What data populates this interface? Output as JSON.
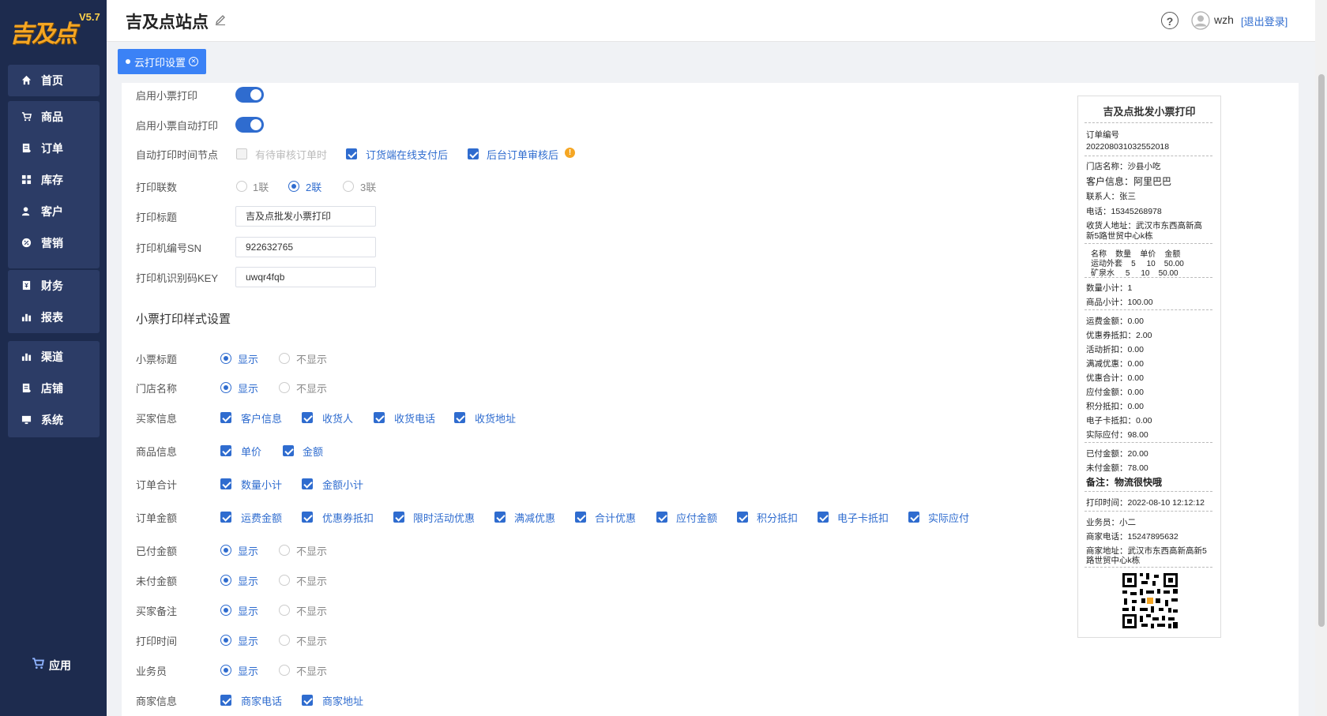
{
  "app": {
    "logo_text": "吉及点",
    "version": "V5.7",
    "site_title": "吉及点站点",
    "username": "wzh",
    "logout_label": "[退出登录]"
  },
  "sidebar": {
    "items": [
      {
        "label": "首页",
        "icon": "home-icon"
      },
      {
        "label": "商品",
        "icon": "cart-icon"
      },
      {
        "label": "订单",
        "icon": "order-icon"
      },
      {
        "label": "库存",
        "icon": "grid-icon"
      },
      {
        "label": "客户",
        "icon": "user-icon"
      },
      {
        "label": "营销",
        "icon": "percent-icon"
      },
      {
        "label": "财务",
        "icon": "finance-icon"
      },
      {
        "label": "报表",
        "icon": "chart-icon"
      },
      {
        "label": "渠道",
        "icon": "chart-icon"
      },
      {
        "label": "店铺",
        "icon": "store-icon"
      },
      {
        "label": "系统",
        "icon": "monitor-icon"
      }
    ],
    "apps_label": "应用"
  },
  "tab": {
    "label": "云打印设置"
  },
  "form": {
    "enable_print": "启用小票打印",
    "enable_auto_print": "启用小票自动打印",
    "auto_time_label": "自动打印时间节点",
    "auto_time_options": [
      "有待审核订单时",
      "订货端在线支付后",
      "后台订单审核后"
    ],
    "copies_label": "打印联数",
    "copies_options": [
      "1联",
      "2联",
      "3联"
    ],
    "copies_selected": "2联",
    "print_title_label": "打印标题",
    "print_title_value": "吉及点批发小票打印",
    "sn_label": "打印机编号SN",
    "sn_value": "922632765",
    "key_label": "打印机识别码KEY",
    "key_value": "uwqr4fqb",
    "style_section": "小票打印样式设置",
    "show": "显示",
    "hide": "不显示",
    "rows": {
      "ticket_title": "小票标题",
      "store_name": "门店名称",
      "buyer_info": "买家信息",
      "buyer_options": [
        "客户信息",
        "收货人",
        "收货电话",
        "收货地址"
      ],
      "goods_info": "商品信息",
      "goods_options": [
        "单价",
        "金额"
      ],
      "order_total": "订单合计",
      "order_total_options": [
        "数量小计",
        "金额小计"
      ],
      "order_amount": "订单金额",
      "order_amount_options": [
        "运费金额",
        "优惠券抵扣",
        "限时活动优惠",
        "满减优惠",
        "合计优惠",
        "应付金额",
        "积分抵扣",
        "电子卡抵扣",
        "实际应付"
      ],
      "paid_amount": "已付金额",
      "unpaid_amount": "未付金额",
      "buyer_note": "买家备注",
      "print_time": "打印时间",
      "salesman": "业务员",
      "merchant_info": "商家信息",
      "merchant_options": [
        "商家电话",
        "商家地址"
      ]
    }
  },
  "receipt": {
    "title": "吉及点批发小票打印",
    "order_no_label": "订单编号",
    "order_no": "20220803103255201​8",
    "store": "门店名称：沙县小吃",
    "customer": "客户信息：阿里巴巴",
    "contact": "联系人：张三",
    "phone": "电话：15345268978",
    "address1": "收货人地址：武汉市东西高新高",
    "address2": "新5路世贸中心k栋",
    "tbl_head": "名称    数量    单价    金额",
    "tbl_r1": "运动外套    5     10    50.00",
    "tbl_r2": "矿泉水     5     10    50.00",
    "qty_total": "数量小计：1",
    "goods_total": "商品小计：100.00",
    "freight": "运费金额：0.00",
    "coupon": "优惠券抵扣：2.00",
    "activity": "活动折扣：0.00",
    "full_reduce": "满减优惠：0.00",
    "discount_total": "优惠合计：0.00",
    "payable": "应付金额：0.00",
    "points": "积分抵扣：0.00",
    "ecard": "电子卡抵扣：0.00",
    "actual": "实际应付：98.00",
    "paid": "已付金额：20.00",
    "unpaid": "未付金额：78.00",
    "note": "备注：物流很快哦",
    "print_time": "打印时间：2022-08-10 12:12:12",
    "salesman": "业务员：小二",
    "merchant_phone": "商家电话：15247895632",
    "merchant_addr1": "商家地址：武汉市东西高新高新5",
    "merchant_addr2": "路世贸中心k栋"
  },
  "colors": {
    "accent": "#2f6ccf",
    "sidebar": "#1d2b4e",
    "sidebar_item": "#2c3c66",
    "warn": "#f5a623"
  }
}
